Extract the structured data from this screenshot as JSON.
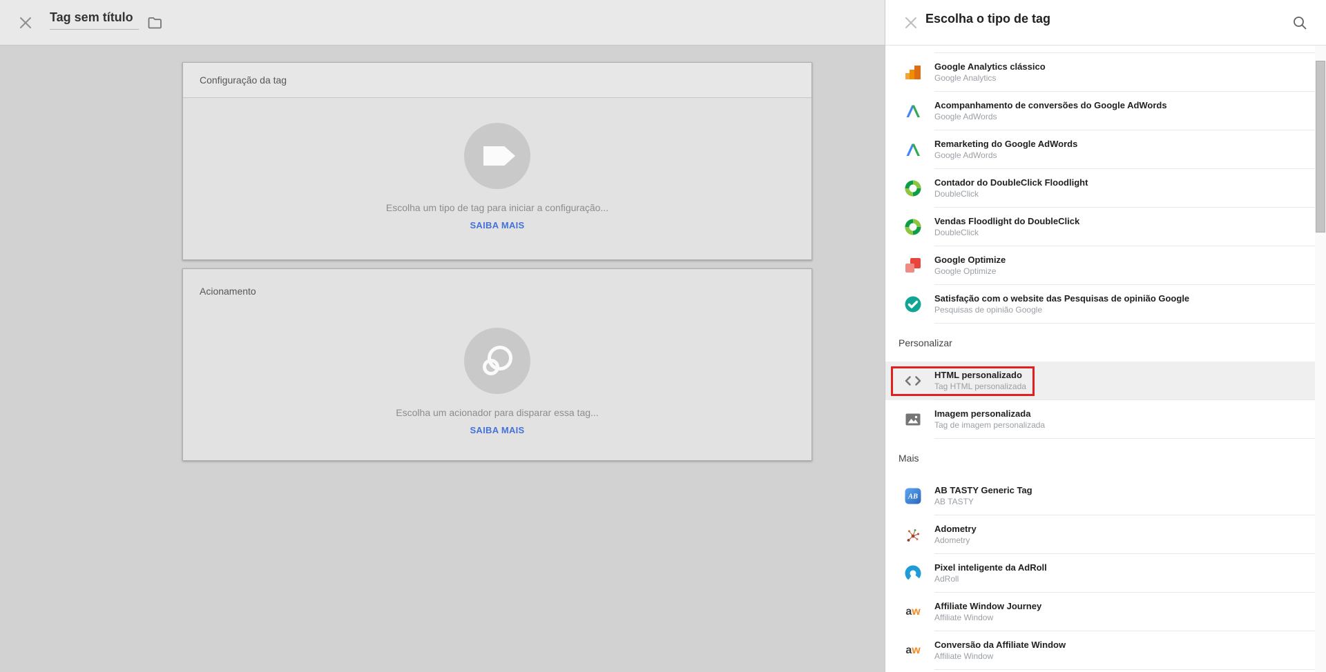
{
  "colors": {
    "link_blue": "#4472d9",
    "highlight_red": "#e01f1f",
    "hover_gray": "#efefef"
  },
  "editor": {
    "window_title": "Tag sem título",
    "cards": [
      {
        "title": "Configuração da tag",
        "caption": "Escolha um tipo de tag para iniciar a configuração...",
        "link_label": "SAIBA MAIS",
        "icon": "tag"
      },
      {
        "title": "Acionamento",
        "caption": "Escolha um acionador para disparar essa tag...",
        "link_label": "SAIBA MAIS",
        "icon": "trigger"
      }
    ]
  },
  "panel": {
    "title": "Escolha o tipo de tag",
    "groups": [
      {
        "header": null,
        "items": [
          {
            "title": "Google Analytics clássico",
            "subtitle": "Google Analytics",
            "icon": "google-analytics"
          },
          {
            "title": "Acompanhamento de conversões do Google AdWords",
            "subtitle": "Google AdWords",
            "icon": "google-adwords"
          },
          {
            "title": "Remarketing do Google AdWords",
            "subtitle": "Google AdWords",
            "icon": "google-adwords"
          },
          {
            "title": "Contador do DoubleClick Floodlight",
            "subtitle": "DoubleClick",
            "icon": "doubleclick"
          },
          {
            "title": "Vendas Floodlight do DoubleClick",
            "subtitle": "DoubleClick",
            "icon": "doubleclick"
          },
          {
            "title": "Google Optimize",
            "subtitle": "Google Optimize",
            "icon": "google-optimize"
          },
          {
            "title": "Satisfação com o website das Pesquisas de opinião Google",
            "subtitle": "Pesquisas de opinião Google",
            "icon": "google-survey"
          }
        ]
      },
      {
        "header": "Personalizar",
        "items": [
          {
            "title": "HTML personalizado",
            "subtitle": "Tag HTML personalizada",
            "icon": "code",
            "highlighted": true
          },
          {
            "title": "Imagem personalizada",
            "subtitle": "Tag de imagem personalizada",
            "icon": "image"
          }
        ]
      },
      {
        "header": "Mais",
        "items": [
          {
            "title": "AB TASTY Generic Tag",
            "subtitle": "AB TASTY",
            "icon": "abtasty"
          },
          {
            "title": "Adometry",
            "subtitle": "Adometry",
            "icon": "adometry"
          },
          {
            "title": "Pixel inteligente da AdRoll",
            "subtitle": "AdRoll",
            "icon": "adroll"
          },
          {
            "title": "Affiliate Window Journey",
            "subtitle": "Affiliate Window",
            "icon": "affiliate-window"
          },
          {
            "title": "Conversão da Affiliate Window",
            "subtitle": "Affiliate Window",
            "icon": "affiliate-window"
          }
        ]
      }
    ]
  }
}
